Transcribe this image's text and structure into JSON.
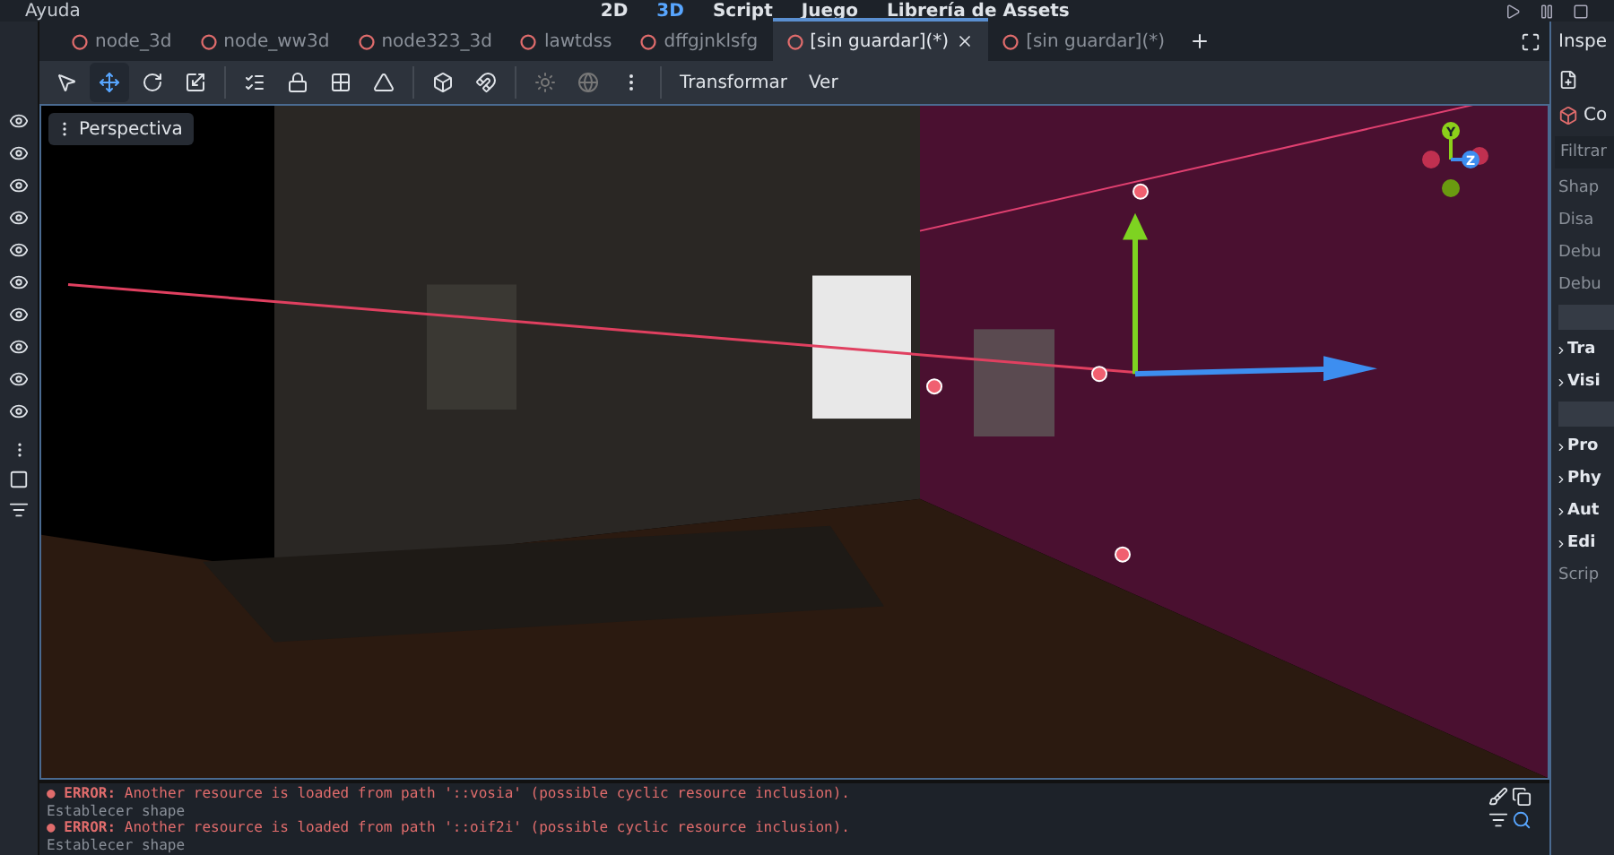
{
  "menu": {
    "items": [
      "Ayuda"
    ]
  },
  "workspaces": [
    {
      "label": "2D",
      "selected": false
    },
    {
      "label": "3D",
      "selected": true
    },
    {
      "label": "Script",
      "selected": false
    },
    {
      "label": "Juego",
      "selected": false
    },
    {
      "label": "Librería de Assets",
      "selected": false
    }
  ],
  "scene_tabs": [
    {
      "label": "node_3d",
      "selected": false
    },
    {
      "label": "node_ww3d",
      "selected": false
    },
    {
      "label": "node323_3d",
      "selected": false
    },
    {
      "label": "lawtdss",
      "selected": false
    },
    {
      "label": "dffgjnklsfg",
      "selected": false
    },
    {
      "label": "[sin guardar](*)",
      "selected": true
    },
    {
      "label": "[sin guardar](*)",
      "selected": false
    }
  ],
  "toolbar": {
    "tools": [
      {
        "kind": "select",
        "selected": false
      },
      {
        "kind": "move",
        "selected": true
      },
      {
        "kind": "rotate",
        "selected": false
      },
      {
        "kind": "scale",
        "selected": false
      }
    ],
    "menus": [
      "Transformar",
      "Ver"
    ]
  },
  "viewport": {
    "view_menu": "Perspectiva",
    "gizmo_axes": [
      "Y",
      "Z"
    ]
  },
  "inspector": {
    "title": "Inspe",
    "node": "Co",
    "filter_placeholder": "Filtrar",
    "properties": [
      {
        "label": "Shap",
        "kind": "plain"
      },
      {
        "label": "Disa",
        "kind": "plain"
      },
      {
        "label": "Debu",
        "kind": "plain"
      },
      {
        "label": "Debu",
        "kind": "plain"
      },
      {
        "kind": "header"
      },
      {
        "label": "Tra",
        "kind": "group"
      },
      {
        "label": "Visi",
        "kind": "group"
      },
      {
        "kind": "header"
      },
      {
        "label": "Pro",
        "kind": "group"
      },
      {
        "label": "Phy",
        "kind": "group"
      },
      {
        "label": "Aut",
        "kind": "group"
      },
      {
        "label": "Edi",
        "kind": "group"
      },
      {
        "label": "Scrip",
        "kind": "plain"
      }
    ]
  },
  "output": {
    "lines": [
      {
        "kind": "error",
        "bullet": "●",
        "tag": "ERROR:",
        "text": "Another resource is loaded from path '::vosia' (possible cyclic resource inclusion)."
      },
      {
        "kind": "info",
        "text": "Establecer shape"
      },
      {
        "kind": "error",
        "bullet": "●",
        "tag": "ERROR:",
        "text": "Another resource is loaded from path '::oif2i' (possible cyclic resource inclusion)."
      },
      {
        "kind": "info",
        "text": "Establecer shape"
      }
    ]
  }
}
